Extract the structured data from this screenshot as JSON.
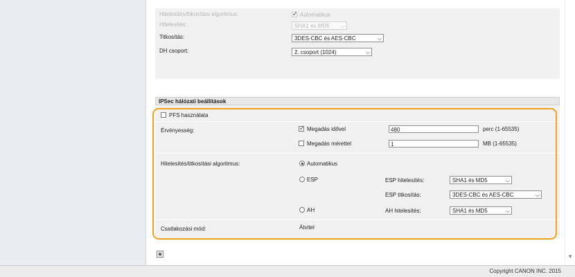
{
  "top_settings": {
    "auth_encrypt_algorithm": {
      "label": "Hitelesítés/titkosítási algoritmus:",
      "check_label": "Automatikus"
    },
    "authentication": {
      "label": "Hitelesítés:",
      "value": "SHA1 és MD5"
    },
    "encryption": {
      "label": "Titkosítás:",
      "value": "3DES-CBC és AES-CBC"
    },
    "dh_group": {
      "label": "DH csoport:",
      "value": "2. csoport (1024)"
    }
  },
  "ipsec": {
    "header": "IPSec hálózati beállítások",
    "pfs_label": "PFS használata",
    "validity_label": "Érvényesség:",
    "by_time_label": "Megadás idővel",
    "by_time_value": "480",
    "by_time_unit": "perc (1-65535)",
    "by_size_label": "Megadás mérettel",
    "by_size_value": "1",
    "by_size_unit": "MB (1-65535)",
    "algorithm_label": "Hitelesítés/titkosítási algoritmus:",
    "auto_label": "Automatikus",
    "esp_label": "ESP",
    "esp_auth_label": "ESP hitelesítés:",
    "esp_auth_value": "SHA1 és MD5",
    "esp_encrypt_label": "ESP titkosítás:",
    "esp_encrypt_value": "3DES-CBC és AES-CBC",
    "ah_label": "AH",
    "ah_auth_label": "AH hitelesítés:",
    "ah_auth_value": "SHA1 és MD5",
    "connection_mode_label": "Csatlakozási mód:",
    "connection_mode_value": "Átvitel"
  },
  "footer": {
    "copyright": "Copyright CANON INC. 2015"
  },
  "highlight_color": "#f0a21a"
}
